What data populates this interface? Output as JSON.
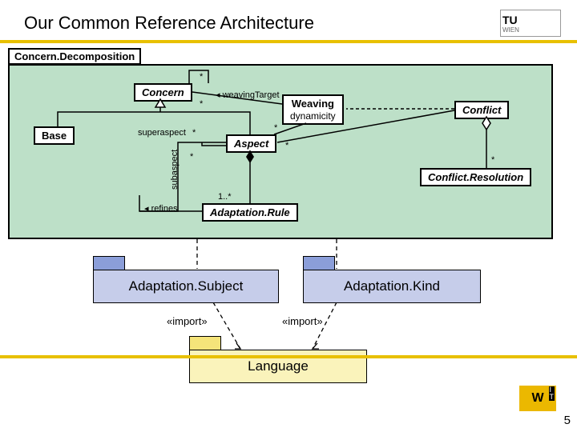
{
  "header": {
    "title": "Our Common Reference Architecture",
    "logo_main": "TU",
    "logo_sub": "WIEN"
  },
  "package": {
    "main_label": "Concern.Decomposition",
    "classes": {
      "concern": "Concern",
      "base": "Base",
      "weaving": "Weaving",
      "dynamicity": "dynamicity",
      "aspect": "Aspect",
      "conflict": "Conflict",
      "conflict_resolution": "Conflict.Resolution",
      "adaptation_rule": "Adaptation.Rule"
    },
    "labels": {
      "weaving_target": "weavingTarget",
      "superaspect": "superaspect",
      "subaspect": "subaspect",
      "refines": "refines",
      "star": "*",
      "one_many": "1..*"
    }
  },
  "packages": {
    "adaptation_subject": "Adaptation.Subject",
    "adaptation_kind": "Adaptation.Kind",
    "language": "Language",
    "import": "«import»"
  },
  "footer": {
    "page": "5",
    "logo": "W"
  }
}
